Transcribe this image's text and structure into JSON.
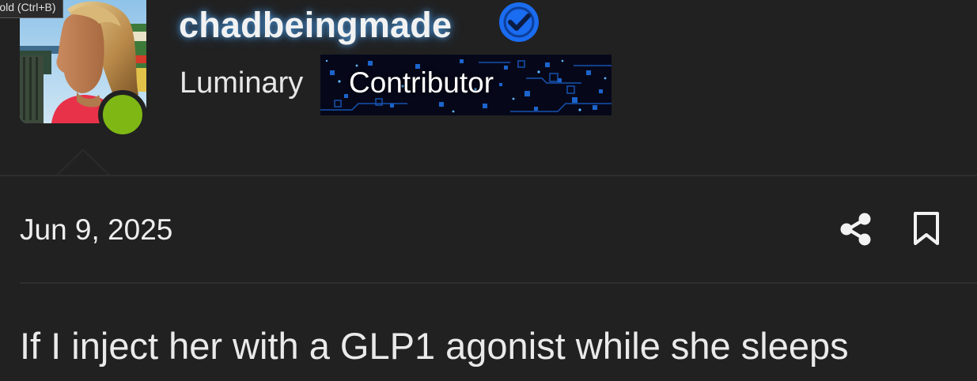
{
  "tooltip": {
    "text": "Bold (Ctrl+B)"
  },
  "profile": {
    "username": "chadbeingmade",
    "verified": true,
    "rank": "Luminary",
    "badge_label": "Contributor",
    "online": true,
    "online_color": "#7fb814",
    "verified_color": "#1a6cf0"
  },
  "post": {
    "date": "Jun 9, 2025",
    "text": "If I inject her with a GLP1 agonist while she sleeps"
  },
  "icons": {
    "share": "share-icon",
    "bookmark": "bookmark-icon",
    "verified": "verified-check-icon"
  },
  "colors": {
    "background": "#212121",
    "text": "#e8e8e8",
    "username_glow": "#5ab4ff"
  }
}
